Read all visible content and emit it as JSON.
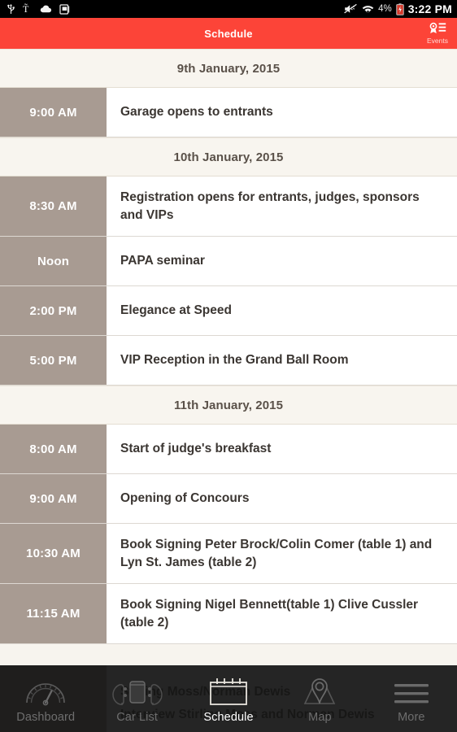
{
  "status_bar": {
    "left_icons": [
      "usb-icon",
      "tsmobile-icon",
      "cloud-upload-icon",
      "screenshot-icon"
    ],
    "right_icons": [
      "mute-icon",
      "wifi-icon",
      "battery-icon"
    ],
    "battery_percent": "4%",
    "clock": "3:22 PM"
  },
  "app_bar": {
    "title": "Schedule",
    "action_label": "Events",
    "action_icon": "events-ribbon-icon",
    "background_color": "#FC4438"
  },
  "colors": {
    "accent_red": "#FC4438",
    "time_column": "#A89B92",
    "date_header_bg": "#F8F5EF",
    "page_bg": "#F7F4EE",
    "row_bg": "#FFFFFF",
    "body_text": "#3B3632"
  },
  "schedule": {
    "sections": [
      {
        "date": "9th January, 2015",
        "events": [
          {
            "time": "9:00 AM",
            "title": "Garage opens to entrants",
            "lines": 1
          }
        ]
      },
      {
        "date": "10th January, 2015",
        "events": [
          {
            "time": "8:30 AM",
            "title": "Registration opens for entrants, judges, sponsors and VIPs",
            "lines": 2
          },
          {
            "time": "Noon",
            "title": "PAPA seminar",
            "lines": 1
          },
          {
            "time": "2:00 PM",
            "title": "Elegance at Speed",
            "lines": 1
          },
          {
            "time": "5:00 PM",
            "title": "VIP Reception in the Grand Ball Room",
            "lines": 1
          }
        ]
      },
      {
        "date": "11th January, 2015",
        "events": [
          {
            "time": "8:00 AM",
            "title": "Start of judge's breakfast",
            "lines": 1
          },
          {
            "time": "9:00 AM",
            "title": "Opening of Concours",
            "lines": 1
          },
          {
            "time": "10:30 AM",
            "title": "Book Signing Peter Brock/Colin Comer (table 1) and Lyn St. James (table 2)",
            "lines": 2
          },
          {
            "time": "11:15 AM",
            "title": "Book Signing Nigel Bennett(table 1) Clive Cussler (table 2)",
            "lines": 2
          }
        ]
      }
    ],
    "obscured_next_event": {
      "line1": "Stirling Moss/Norman Dewis",
      "line2": "Interview Stirling Moss and Norman Dewis"
    }
  },
  "tab_bar": {
    "tabs": [
      {
        "label": "Dashboard",
        "icon": "speedometer-icon",
        "active": false
      },
      {
        "label": "Car List",
        "icon": "car-front-icon",
        "active": false
      },
      {
        "label": "Schedule",
        "icon": "calendar-icon",
        "active": true
      },
      {
        "label": "Map",
        "icon": "map-pin-icon",
        "active": false
      },
      {
        "label": "More",
        "icon": "hamburger-menu-icon",
        "active": false
      }
    ]
  }
}
